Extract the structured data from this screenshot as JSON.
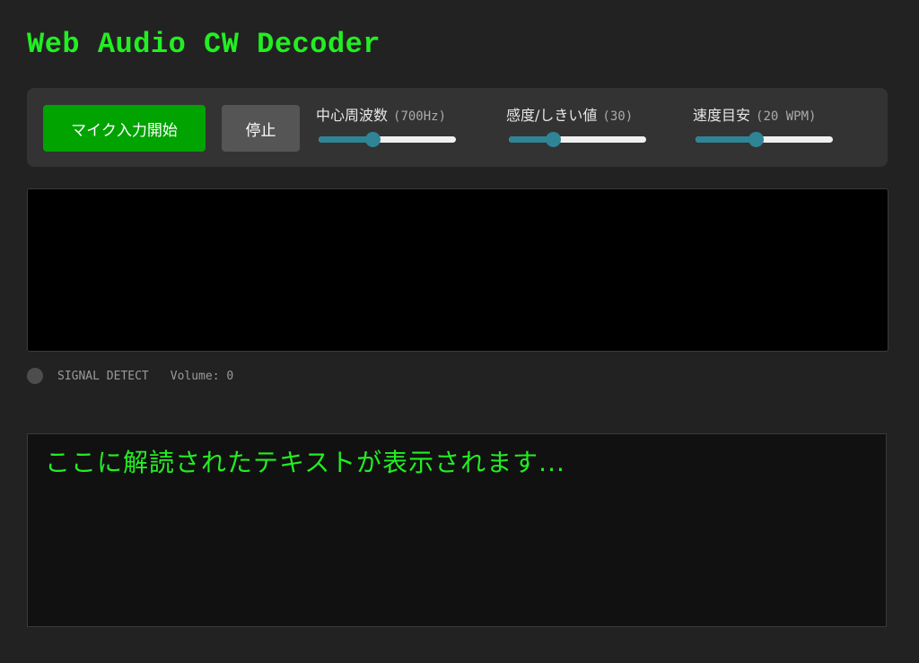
{
  "app": {
    "title": "Web Audio CW Decoder"
  },
  "controls": {
    "start_label": "マイク入力開始",
    "stop_label": "停止",
    "frequency": {
      "label": "中心周波数",
      "value_text": "(700Hz)",
      "level": 0.39
    },
    "threshold": {
      "label": "感度/しきい値",
      "value_text": "(30)",
      "level": 0.32
    },
    "speed": {
      "label": "速度目安",
      "value_text": "(20 WPM)",
      "level": 0.44
    }
  },
  "status": {
    "signal_label": "SIGNAL DETECT",
    "volume_text": "Volume: 0"
  },
  "output": {
    "placeholder": "ここに解読されたテキストが表示されます..."
  },
  "colors": {
    "accent": "#22ee22",
    "start_button": "#00a300",
    "stop_button": "#555555",
    "slider_accent": "#2f8496",
    "led_off": "#4d4d4d"
  }
}
